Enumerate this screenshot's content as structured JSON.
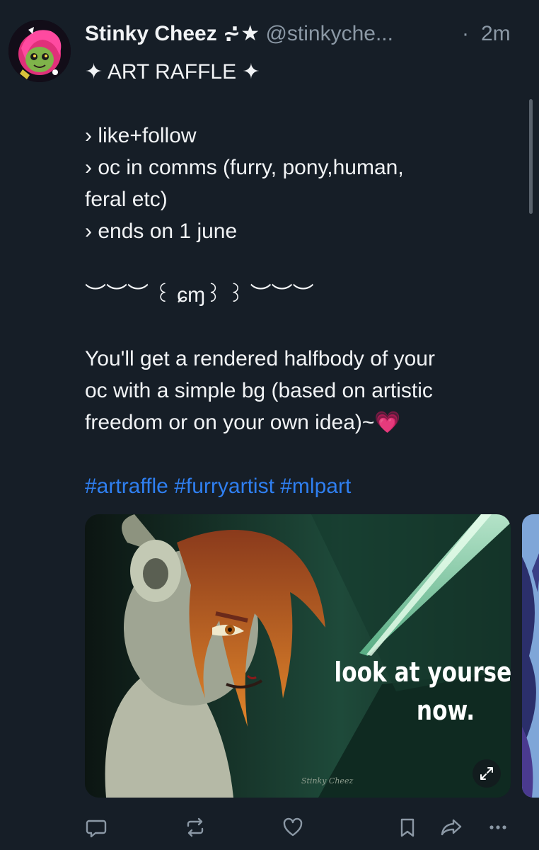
{
  "post": {
    "author": {
      "display_name": "Stinky Cheez ⩫★",
      "handle": "@stinkyche...",
      "separator": "·",
      "time": "2m"
    },
    "text": {
      "title": "✦ ART RAFFLE ✦",
      "rules": [
        "› like+follow",
        "› oc in comms (furry, pony,human,",
        "feral etc)",
        "› ends on 1 june"
      ],
      "divider": "︶︶︶ ꒰ ɕɱ꒱ ꒱ ︶︶︶",
      "description": [
        "You'll get a rendered halfbody of your",
        "oc with a simple bg (based on  artistic",
        "freedom or on your own idea)~💗"
      ],
      "hashtags": [
        "#artraffle",
        "#furryartist",
        "#mlpart"
      ]
    },
    "media": {
      "caption_line1": "look at yourself",
      "caption_line2": "now.",
      "signature": "Stinky Cheez",
      "expand_icon": "expand-arrows-icon"
    }
  },
  "actions": {
    "reply_icon": "reply-icon",
    "repost_icon": "repost-icon",
    "like_icon": "heart-icon",
    "bookmark_icon": "bookmark-icon",
    "share_icon": "share-icon",
    "more_icon": "more-icon"
  },
  "colors": {
    "background": "#161e27",
    "text": "#f1f3f5",
    "muted": "#8b98a5",
    "link": "#2f7ff0"
  }
}
